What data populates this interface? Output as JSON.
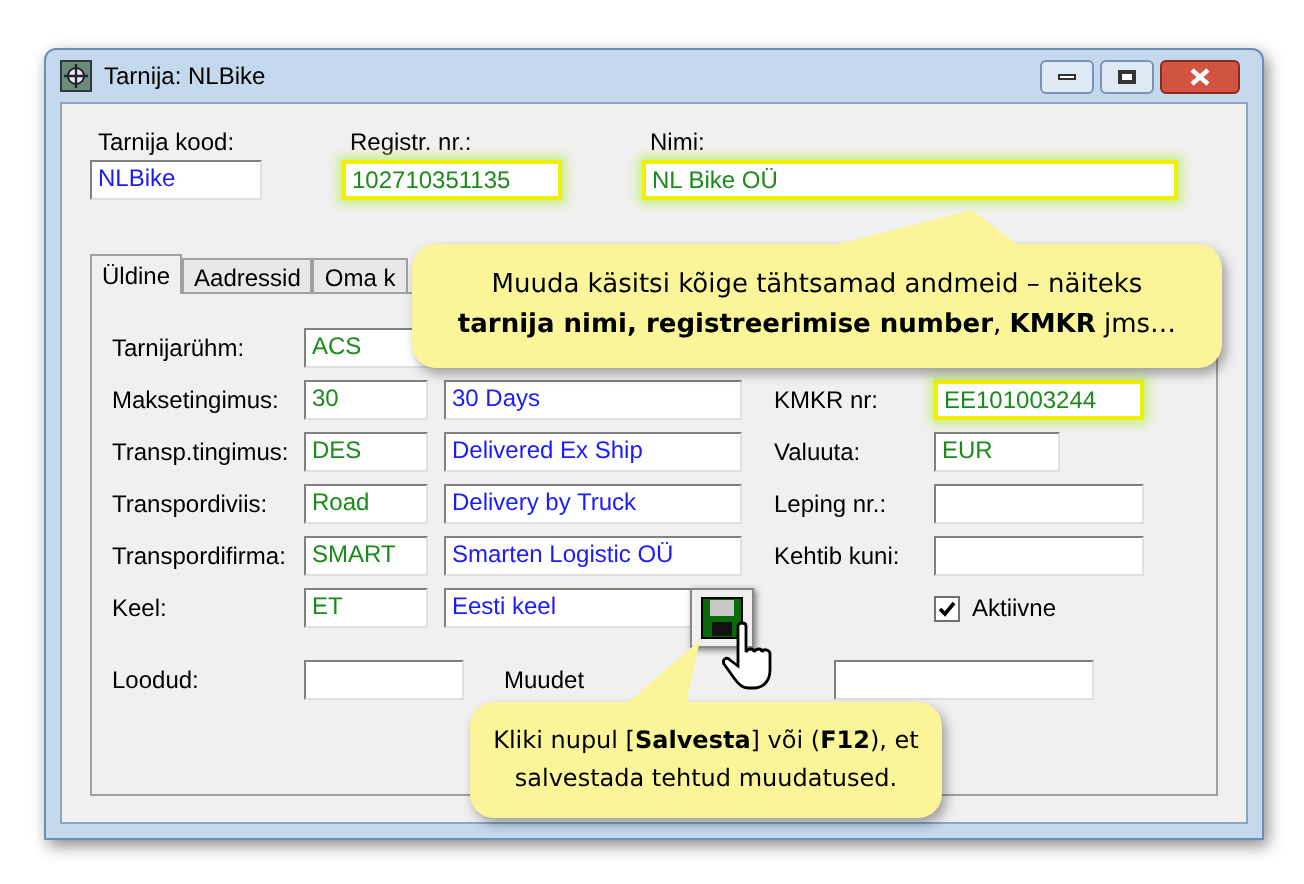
{
  "window": {
    "title": "Tarnija: NLBike"
  },
  "header_fields": [
    {
      "label": "Tarnija kood:",
      "value": "NLBike",
      "kind": "description",
      "highlighted": false
    },
    {
      "label": "Registr. nr.:",
      "value": "102710351135",
      "kind": "code",
      "highlighted": true
    },
    {
      "label": "Nimi:",
      "value": "NL Bike OÜ",
      "kind": "code",
      "highlighted": true
    }
  ],
  "tabs": [
    {
      "label": "Üldine",
      "selected": true
    },
    {
      "label": "Aadressid",
      "selected": false
    },
    {
      "label": "Oma k",
      "selected": false
    }
  ],
  "left_rows": [
    {
      "label": "Tarnijarühm:",
      "code": "ACS"
    },
    {
      "label": "Maksetingimus:",
      "code": "30",
      "description": "30 Days"
    },
    {
      "label": "Transp.tingimus:",
      "code": "DES",
      "description": "Delivered Ex Ship"
    },
    {
      "label": "Transpordiviis:",
      "code": "Road",
      "description": "Delivery by Truck"
    },
    {
      "label": "Transpordifirma:",
      "code": "SMART",
      "description": "Smarten Logistic OÜ"
    },
    {
      "label": "Keel:",
      "code": "ET",
      "description": "Eesti keel"
    }
  ],
  "right_rows": [
    {
      "label": "KMKR nr:",
      "value": "EE101003244",
      "highlighted": true,
      "kind": "wide"
    },
    {
      "label": "Valuuta:",
      "value": "EUR",
      "highlighted": false,
      "kind": "narrow"
    },
    {
      "label": "Leping nr.:",
      "highlighted": false,
      "kind": "wide"
    },
    {
      "label": "Kehtib kuni:",
      "highlighted": false,
      "kind": "wide"
    }
  ],
  "active_checkbox": {
    "label": "Aktiivne",
    "checked": true
  },
  "bottom_fields": [
    {
      "label": "Loodud:"
    },
    {
      "label": "Muudet"
    }
  ],
  "callouts": [
    {
      "text": "Muuda käsitsi kõige tähtsamad andmeid – näiteks **tarnija nimi, registreerimise number**, **KMKR** jms…"
    },
    {
      "text": "Kliki nupul [**Salvesta**] või (**F12**), et salvestada tehtud muudatused."
    }
  ]
}
